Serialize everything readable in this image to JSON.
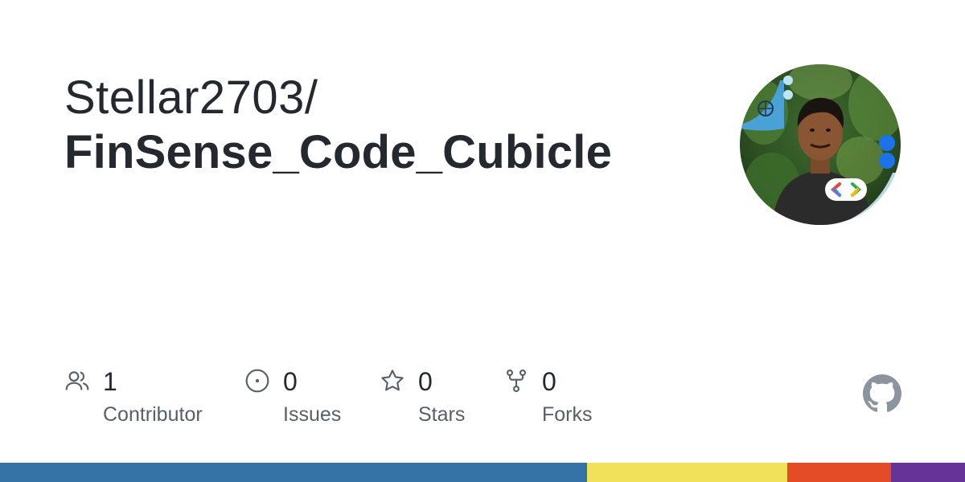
{
  "repo": {
    "owner": "Stellar2703/",
    "name": "FinSense_Code_Cubicle"
  },
  "stats": [
    {
      "icon": "people-icon",
      "value": "1",
      "label": "Contributor"
    },
    {
      "icon": "issue-opened-icon",
      "value": "0",
      "label": "Issues"
    },
    {
      "icon": "star-icon",
      "value": "0",
      "label": "Stars"
    },
    {
      "icon": "repo-forked-icon",
      "value": "0",
      "label": "Forks"
    }
  ],
  "colors": {
    "text_primary": "#24292f",
    "text_secondary": "#57606a",
    "icon_gray": "#57606a",
    "github_logo": "#8c959f"
  },
  "language_bar": [
    {
      "color": "#3572A5",
      "fraction": 0.608
    },
    {
      "color": "#f1e05a",
      "fraction": 0.208
    },
    {
      "color": "#e34c26",
      "fraction": 0.107
    },
    {
      "color": "#663399",
      "fraction": 0.077
    }
  ]
}
